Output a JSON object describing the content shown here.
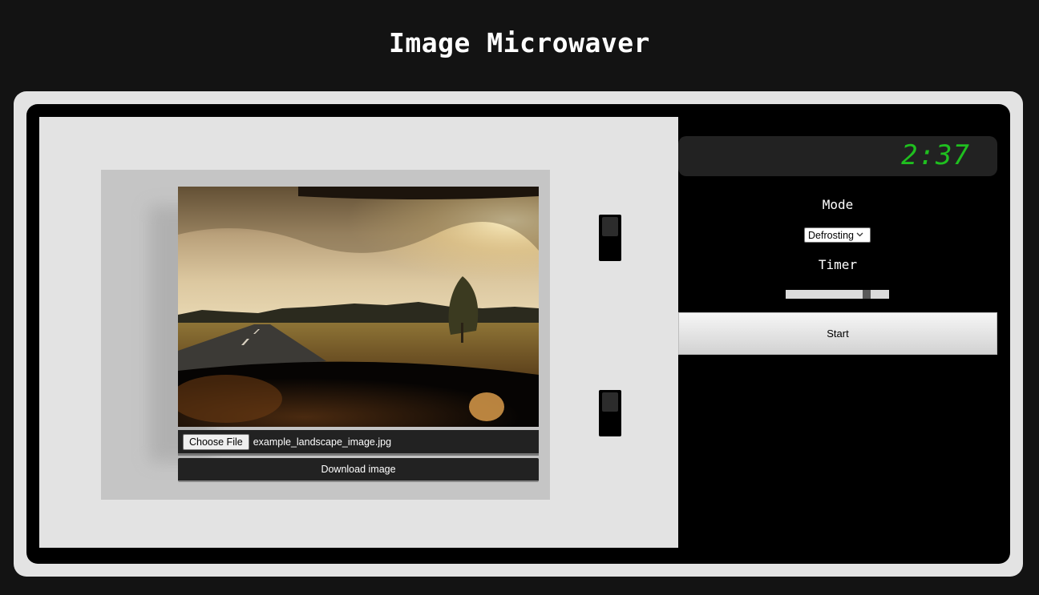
{
  "page": {
    "title": "Image Microwaver"
  },
  "clock": {
    "display": "2:37",
    "color": "#1fbf1f"
  },
  "controls": {
    "mode_label": "Mode",
    "mode_selected": "Defrosting",
    "timer_label": "Timer",
    "timer_fraction": 0.81,
    "start_label": "Start"
  },
  "door": {
    "image_alt": "example landscape image",
    "file_button_label": "Choose File",
    "file_name": "example_landscape_image.jpg",
    "download_label": "Download image"
  },
  "icons": {
    "select_chevron": "chevron-down-icon"
  }
}
